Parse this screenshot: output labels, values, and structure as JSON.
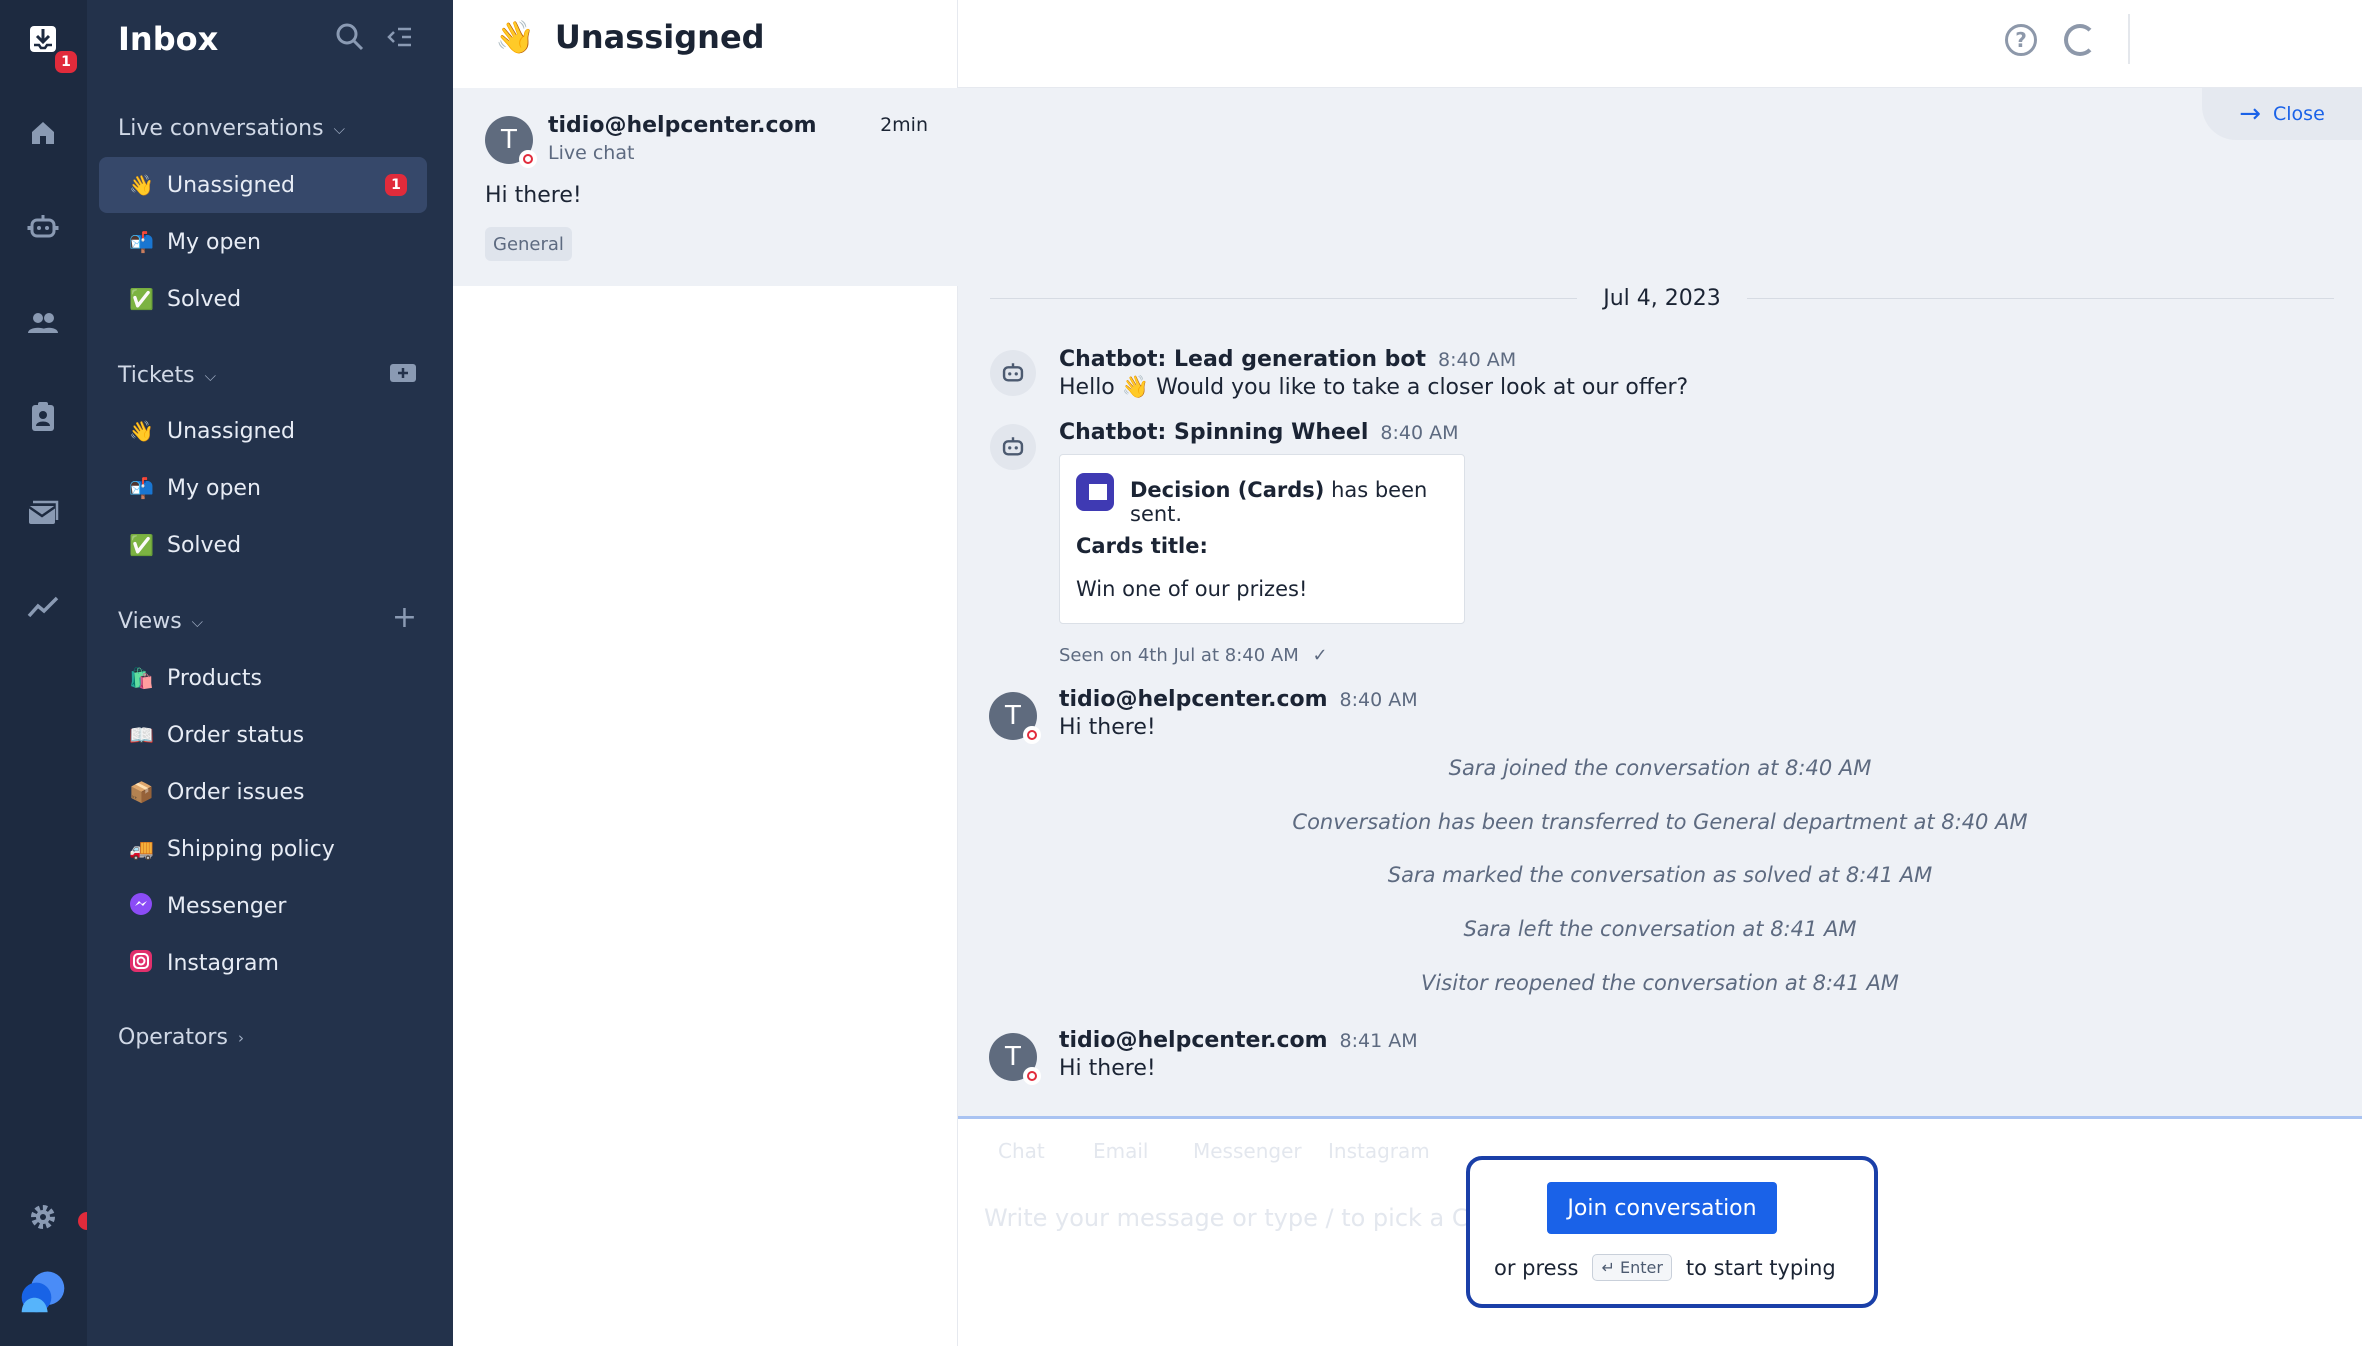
{
  "rail": {
    "inbox_badge": "1",
    "icons": [
      "inbox-icon",
      "home-icon",
      "bot-icon",
      "visitors-icon",
      "contacts-icon",
      "mail-icon",
      "analytics-icon",
      "settings-icon",
      "app-logo"
    ]
  },
  "nav": {
    "title": "Inbox",
    "live": {
      "title": "Live conversations",
      "items": [
        {
          "label": "Unassigned",
          "emoji": "👋",
          "badge": "1"
        },
        {
          "label": "My open",
          "emoji": "📬"
        },
        {
          "label": "Solved",
          "emoji": "✅"
        }
      ]
    },
    "tickets": {
      "title": "Tickets",
      "items": [
        {
          "label": "Unassigned",
          "emoji": "👋"
        },
        {
          "label": "My open",
          "emoji": "📬"
        },
        {
          "label": "Solved",
          "emoji": "✅"
        }
      ]
    },
    "views": {
      "title": "Views",
      "items": [
        {
          "label": "Products",
          "emoji": "🛍️"
        },
        {
          "label": "Order status",
          "emoji": "📖"
        },
        {
          "label": "Order issues",
          "emoji": "📦"
        },
        {
          "label": "Shipping policy",
          "emoji": "🚚"
        },
        {
          "label": "Messenger",
          "emoji": "💬"
        },
        {
          "label": "Instagram",
          "emoji": "📷"
        }
      ]
    },
    "operators": {
      "title": "Operators"
    }
  },
  "list": {
    "title": "Unassigned",
    "title_emoji": "👋",
    "items": [
      {
        "avatar": "T",
        "email": "tidio@helpcenter.com",
        "channel": "Live chat",
        "time": "2min",
        "preview": "Hi there!",
        "tag": "General"
      }
    ]
  },
  "chat": {
    "close_label": "Close",
    "date": "Jul 4, 2023",
    "messages": [
      {
        "sender": "Chatbot: Lead generation bot",
        "time": "8:40 AM",
        "text": "Hello 👋 Would you like to take a closer look at our offer?"
      },
      {
        "sender": "Chatbot: Spinning Wheel",
        "time": "8:40 AM"
      },
      {
        "sender": "tidio@helpcenter.com",
        "time": "8:40 AM",
        "text": "Hi there!",
        "avatar": "T"
      },
      {
        "sender": "tidio@helpcenter.com",
        "time": "8:41 AM",
        "text": "Hi there!",
        "avatar": "T"
      }
    ],
    "card": {
      "head_bold": "Decision (Cards)",
      "head_rest": "has been sent.",
      "label": "Cards title:",
      "value": "Win one of our prizes!"
    },
    "seen": "Seen on 4th Jul at 8:40 AM",
    "system": [
      "Sara joined the conversation at 8:40 AM",
      "Conversation has been transferred to General department at 8:40 AM",
      "Sara marked the conversation as solved at 8:41 AM",
      "Sara left the conversation at 8:41 AM",
      "Visitor reopened the conversation at 8:41 AM"
    ]
  },
  "composer": {
    "placeholder": "Write your message or type / to pick a Canned Response",
    "tabs": [
      "Chat",
      "Email",
      "Messenger",
      "Instagram"
    ],
    "join_label": "Join conversation",
    "hint_before": "or press",
    "hint_key": "↵ Enter",
    "hint_after": "to start typing"
  },
  "colors": {
    "accent": "#1a62e8",
    "sidebar": "#23324b",
    "rail": "#1d2a40",
    "badge": "#e12b3b"
  }
}
